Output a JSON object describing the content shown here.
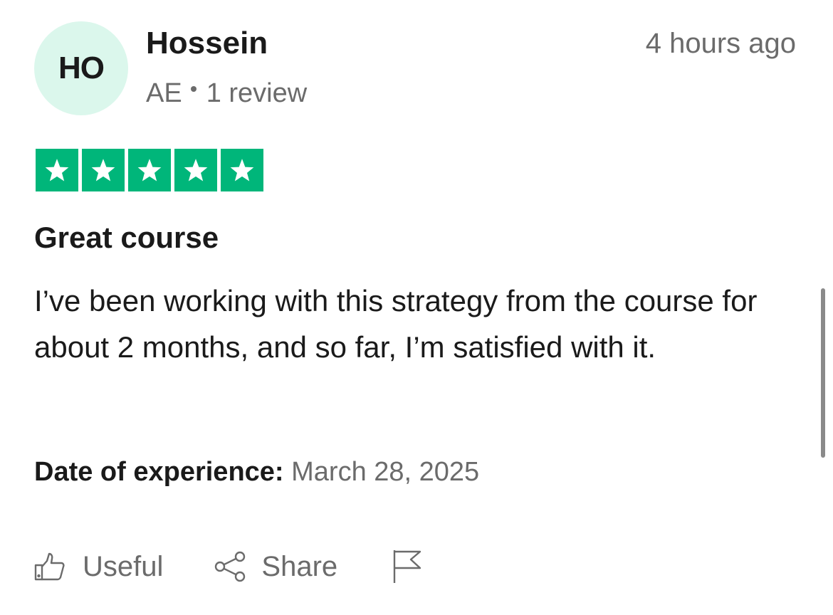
{
  "review": {
    "avatar_initials": "HO",
    "reviewer_name": "Hossein",
    "country": "AE",
    "review_count": "1 review",
    "time_ago": "4 hours ago",
    "rating": 5,
    "rating_max": 5,
    "title": "Great course",
    "body": "I’ve been working with this strategy from the course for about 2 months, and so far, I’m satisfied with it.",
    "date_label": "Date of experience:",
    "date_value": "March 28, 2025"
  },
  "actions": {
    "useful_label": "Useful",
    "share_label": "Share"
  },
  "icons": {
    "useful": "thumbs-up-icon",
    "share": "share-icon",
    "report": "flag-icon",
    "star": "star-icon"
  },
  "colors": {
    "star_bg": "#00b67a",
    "avatar_bg": "#dbf7ec",
    "muted_text": "#6b6b6b",
    "primary_text": "#1a1a1a"
  }
}
